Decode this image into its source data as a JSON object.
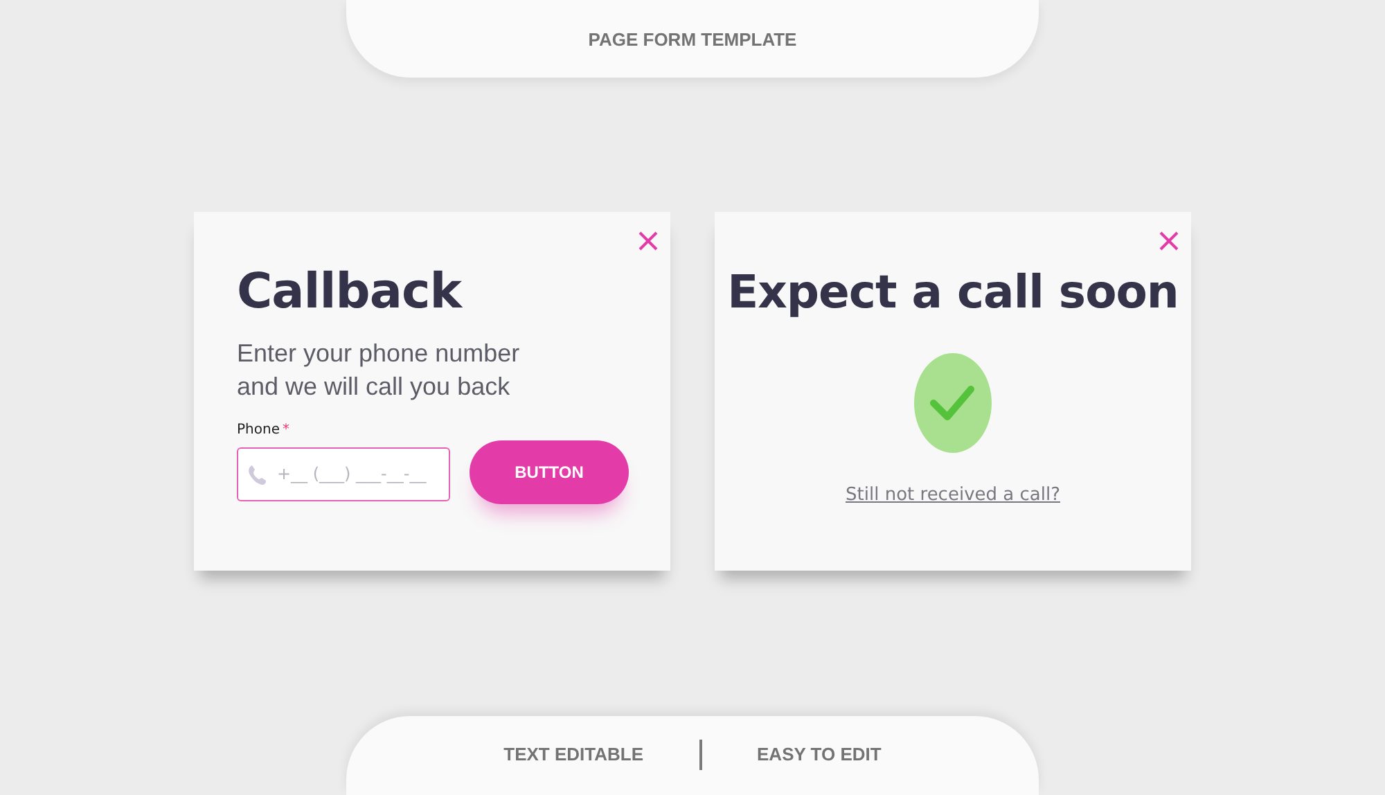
{
  "header": {
    "title": "PAGE FORM TEMPLATE"
  },
  "callback_dialog": {
    "title": "Callback",
    "description": "Enter your phone number and we will call you back",
    "phone_field": {
      "label": "Phone",
      "required_mark": "*",
      "placeholder": "+__ (___) ___-__-__"
    },
    "submit_button": "BUTTON"
  },
  "confirmation_dialog": {
    "title": "Expect a call soon",
    "link": "Still not received a call?"
  },
  "footer": {
    "items": [
      "TEXT EDITABLE",
      "EASY TO EDIT"
    ]
  }
}
